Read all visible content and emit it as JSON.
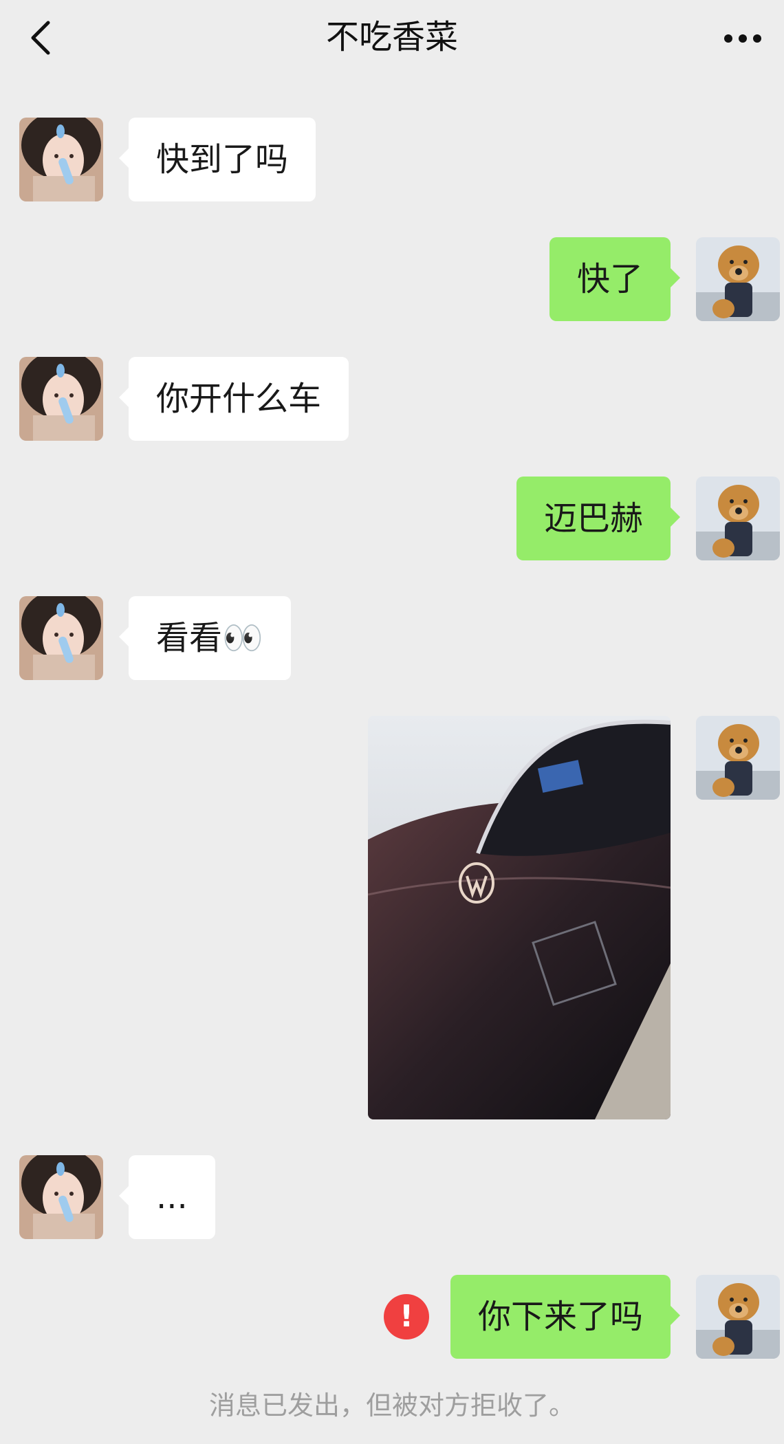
{
  "header": {
    "back_icon": "chevron-left-icon",
    "title": "不吃香菜",
    "more_icon": "ellipsis-icon"
  },
  "messages": [
    {
      "side": "incoming",
      "text": "快到了吗"
    },
    {
      "side": "outgoing",
      "text": "快了"
    },
    {
      "side": "incoming",
      "text": "你开什么车"
    },
    {
      "side": "outgoing",
      "text": "迈巴赫"
    },
    {
      "side": "incoming",
      "text": "看看👀"
    },
    {
      "side": "outgoing",
      "type": "image",
      "image_subject": "black car with Maybach emblem"
    },
    {
      "side": "incoming",
      "text": "..."
    },
    {
      "side": "outgoing",
      "text": "你下来了吗",
      "status": "failed"
    }
  ],
  "system_note": "消息已发出，但被对方拒收了。",
  "colors": {
    "background": "#EDEDED",
    "incoming_bubble": "#FFFFFF",
    "outgoing_bubble": "#95EC69",
    "error": "#F04040",
    "system_text": "#9E9E9E"
  }
}
